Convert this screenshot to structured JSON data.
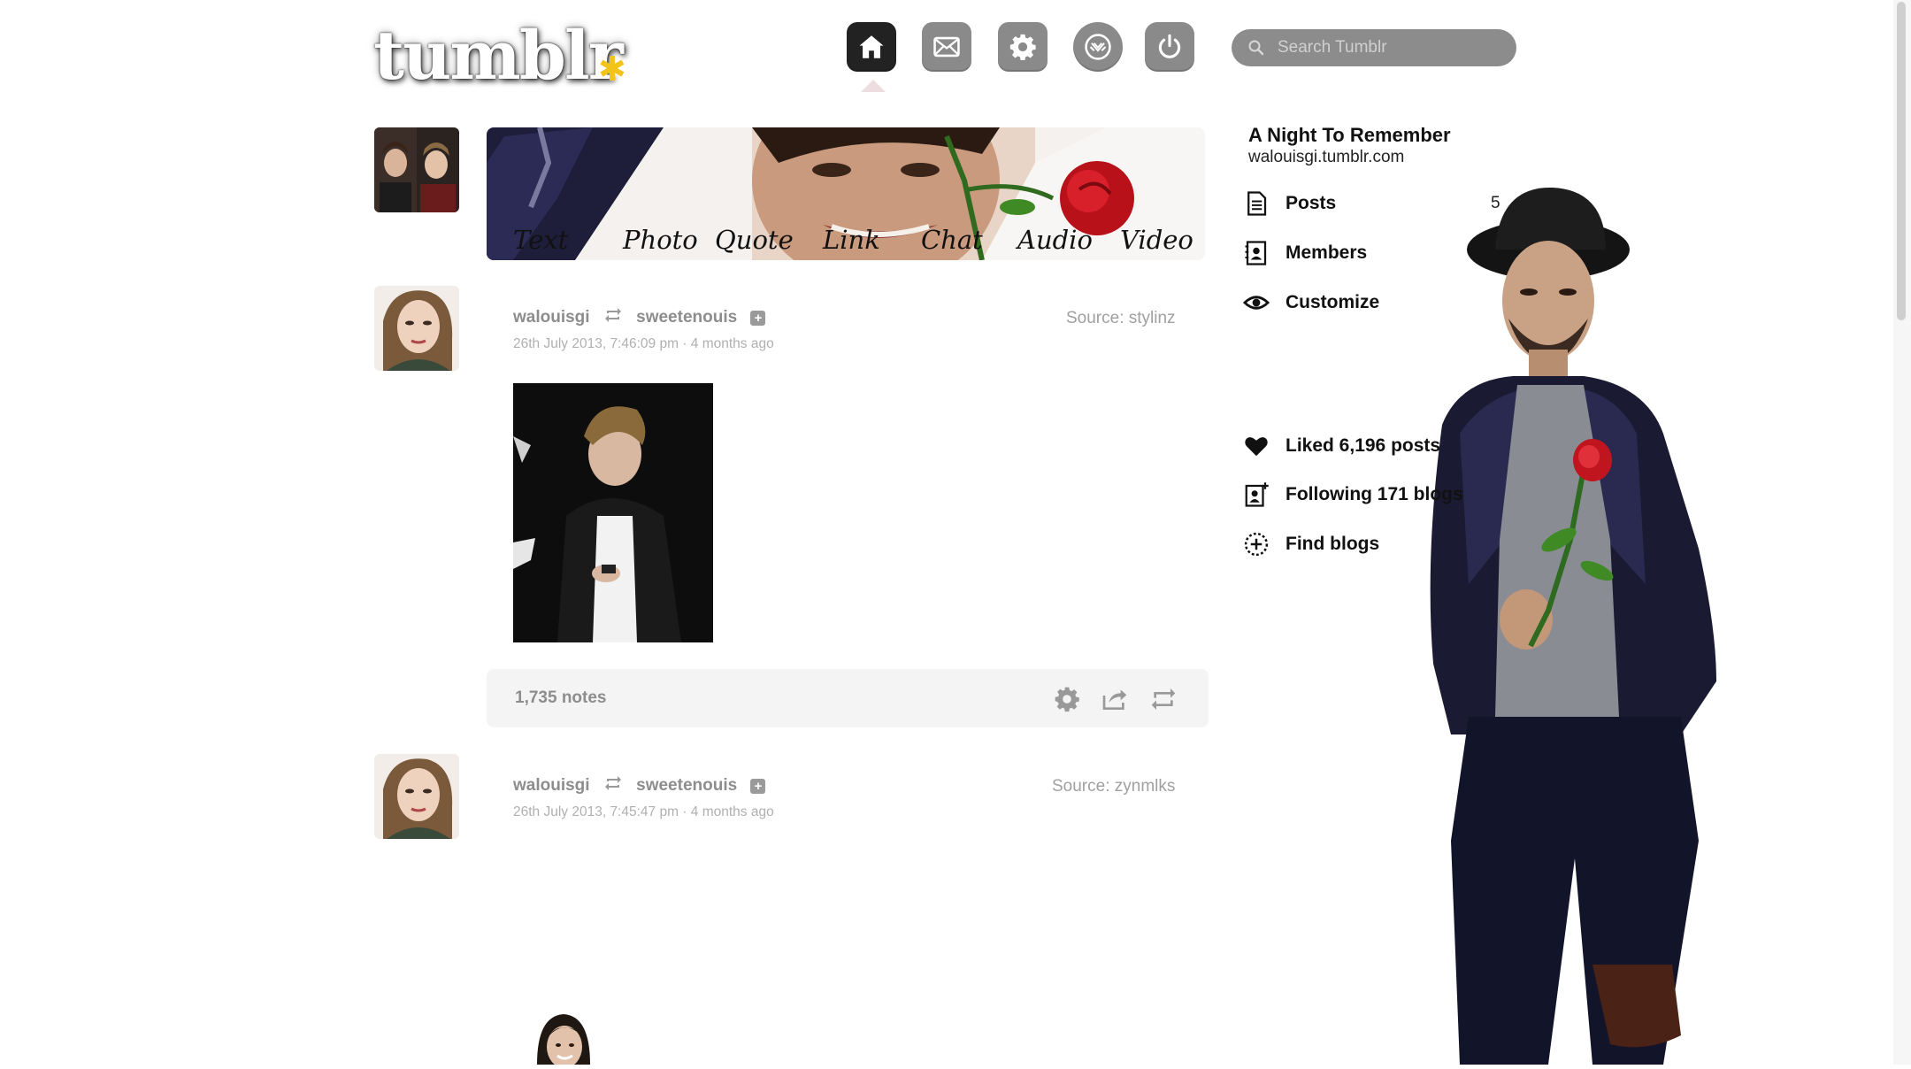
{
  "header": {
    "logo_text": "tumblr",
    "logo_star": "✱",
    "nav": [
      {
        "name": "home",
        "icon": "home-icon",
        "active": true
      },
      {
        "name": "messages",
        "icon": "mail-icon",
        "active": false
      },
      {
        "name": "settings",
        "icon": "gear-icon",
        "active": false
      },
      {
        "name": "explore",
        "icon": "explore-icon",
        "active": false
      },
      {
        "name": "logout",
        "icon": "power-icon",
        "active": false
      }
    ],
    "search": {
      "placeholder": "Search Tumblr",
      "value": ""
    }
  },
  "post_types": [
    "Text",
    "Photo",
    "Quote",
    "Link",
    "Chat",
    "Audio",
    "Video"
  ],
  "posts": [
    {
      "author": "walouisgi",
      "reblogged_from": "sweetenouis",
      "date": "26th July 2013, 7:46:09 pm · 4 months ago",
      "source": "Source: stylinz",
      "notes": "1,735 notes"
    },
    {
      "author": "walouisgi",
      "reblogged_from": "sweetenouis",
      "date": "26th July 2013, 7:45:47 pm · 4 months ago",
      "source": "Source: zynmlks"
    }
  ],
  "sidebar": {
    "title": "A Night To Remember",
    "url": "walouisgi.tumblr.com",
    "posts_label": "Posts",
    "posts_count": "5",
    "members_label": "Members",
    "customize_label": "Customize",
    "liked_label": "Liked 6,196 posts",
    "following_label": "Following 171 blogs",
    "find_label": "Find blogs"
  },
  "colors": {
    "nav_active": "#222222",
    "nav_inactive": "#8a8a8a",
    "search_bg": "#8c8c8c",
    "logo_star": "#f2c318"
  }
}
